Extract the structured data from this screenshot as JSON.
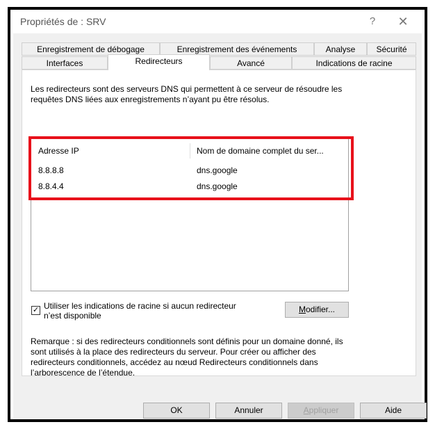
{
  "window": {
    "title": "Propriétés de : SRV",
    "help_glyph": "?",
    "close_glyph": "✕"
  },
  "tabs": {
    "row1": [
      {
        "label": "Enregistrement de débogage"
      },
      {
        "label": "Enregistrement des événements"
      },
      {
        "label": "Analyse"
      },
      {
        "label": "Sécurité"
      }
    ],
    "row2": [
      {
        "label": "Interfaces"
      },
      {
        "label": "Redirecteurs",
        "active": true
      },
      {
        "label": "Avancé"
      },
      {
        "label": "Indications de racine"
      }
    ]
  },
  "forwarders": {
    "description": "Les redirecteurs sont des serveurs DNS qui permettent à ce serveur de résoudre les requêtes DNS liées aux enregistrements n’ayant pu être résolus.",
    "columns": [
      "Adresse IP",
      "Nom de domaine complet du ser..."
    ],
    "rows": [
      {
        "ip": "8.8.8.8",
        "fqdn": "dns.google"
      },
      {
        "ip": "8.8.4.4",
        "fqdn": "dns.google"
      }
    ],
    "use_root_hints_label": "Utiliser les indications de racine si aucun redirecteur n’est disponible",
    "use_root_hints_checked": true,
    "check_glyph": "✓",
    "edit_button": {
      "mnemonic": "M",
      "rest": "odifier..."
    },
    "note": "Remarque : si des redirecteurs conditionnels sont définis pour un domaine donné, ils sont utilisés à la place des redirecteurs du serveur. Pour créer ou afficher des redirecteurs conditionnels, accédez au nœud Redirecteurs conditionnels dans l’arborescence de l’étendue."
  },
  "footer": {
    "ok": "OK",
    "cancel": "Annuler",
    "apply": {
      "mnemonic": "A",
      "rest": "ppliquer"
    },
    "help": "Aide"
  },
  "colors": {
    "highlight": "#e8111b",
    "dialog_bg": "#f0f0f0"
  }
}
